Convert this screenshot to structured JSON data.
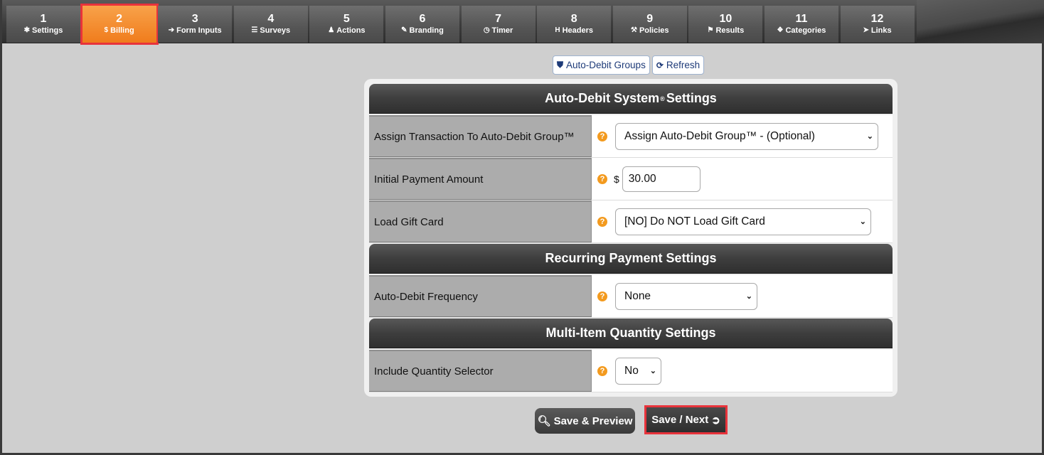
{
  "tabs": [
    {
      "num": "1",
      "label": "Settings",
      "icon": "gear-icon",
      "glyph": "✱"
    },
    {
      "num": "2",
      "label": "Billing",
      "icon": "dollar-icon",
      "glyph": "$"
    },
    {
      "num": "3",
      "label": "Form Inputs",
      "icon": "sign-in-icon",
      "glyph": "➔"
    },
    {
      "num": "4",
      "label": "Surveys",
      "icon": "list-icon",
      "glyph": "☰"
    },
    {
      "num": "5",
      "label": "Actions",
      "icon": "user-icon",
      "glyph": "♟"
    },
    {
      "num": "6",
      "label": "Branding",
      "icon": "brush-icon",
      "glyph": "✎"
    },
    {
      "num": "7",
      "label": "Timer",
      "icon": "clock-icon",
      "glyph": "◷"
    },
    {
      "num": "8",
      "label": "Headers",
      "icon": "header-icon",
      "glyph": "H"
    },
    {
      "num": "9",
      "label": "Policies",
      "icon": "gavel-icon",
      "glyph": "⚒"
    },
    {
      "num": "10",
      "label": "Results",
      "icon": "flag-icon",
      "glyph": "⚑"
    },
    {
      "num": "11",
      "label": "Categories",
      "icon": "cubes-icon",
      "glyph": "❖"
    },
    {
      "num": "12",
      "label": "Links",
      "icon": "pointer-icon",
      "glyph": "➤"
    }
  ],
  "active_tab": "2",
  "toolbar": {
    "auto_debit_groups": "Auto-Debit Groups",
    "refresh": "Refresh"
  },
  "sections": {
    "auto_debit": {
      "title_pre": "Auto-Debit System",
      "title_mark": "®",
      "title_post": " Settings"
    },
    "recurring": {
      "title": "Recurring Payment Settings"
    },
    "multi_item": {
      "title": "Multi-Item Quantity Settings"
    }
  },
  "fields": {
    "assign_group": {
      "label": "Assign Transaction To Auto-Debit Group™",
      "value": "Assign Auto-Debit Group™ - (Optional)"
    },
    "initial_payment": {
      "label": "Initial Payment Amount",
      "currency": "$",
      "value": "30.00"
    },
    "gift_card": {
      "label": "Load Gift Card",
      "value": "[NO] Do NOT Load Gift Card"
    },
    "frequency": {
      "label": "Auto-Debit Frequency",
      "value": "None"
    },
    "quantity": {
      "label": "Include Quantity Selector",
      "value": "No"
    }
  },
  "help_glyph": "?",
  "chevron_glyph": "⌄",
  "actions": {
    "save_preview": "Save & Preview",
    "save_next": "Save / Next"
  },
  "colors": {
    "accent_orange": "#f07c1c",
    "highlight_red": "#e8333b",
    "link_blue": "#1d3a78"
  }
}
